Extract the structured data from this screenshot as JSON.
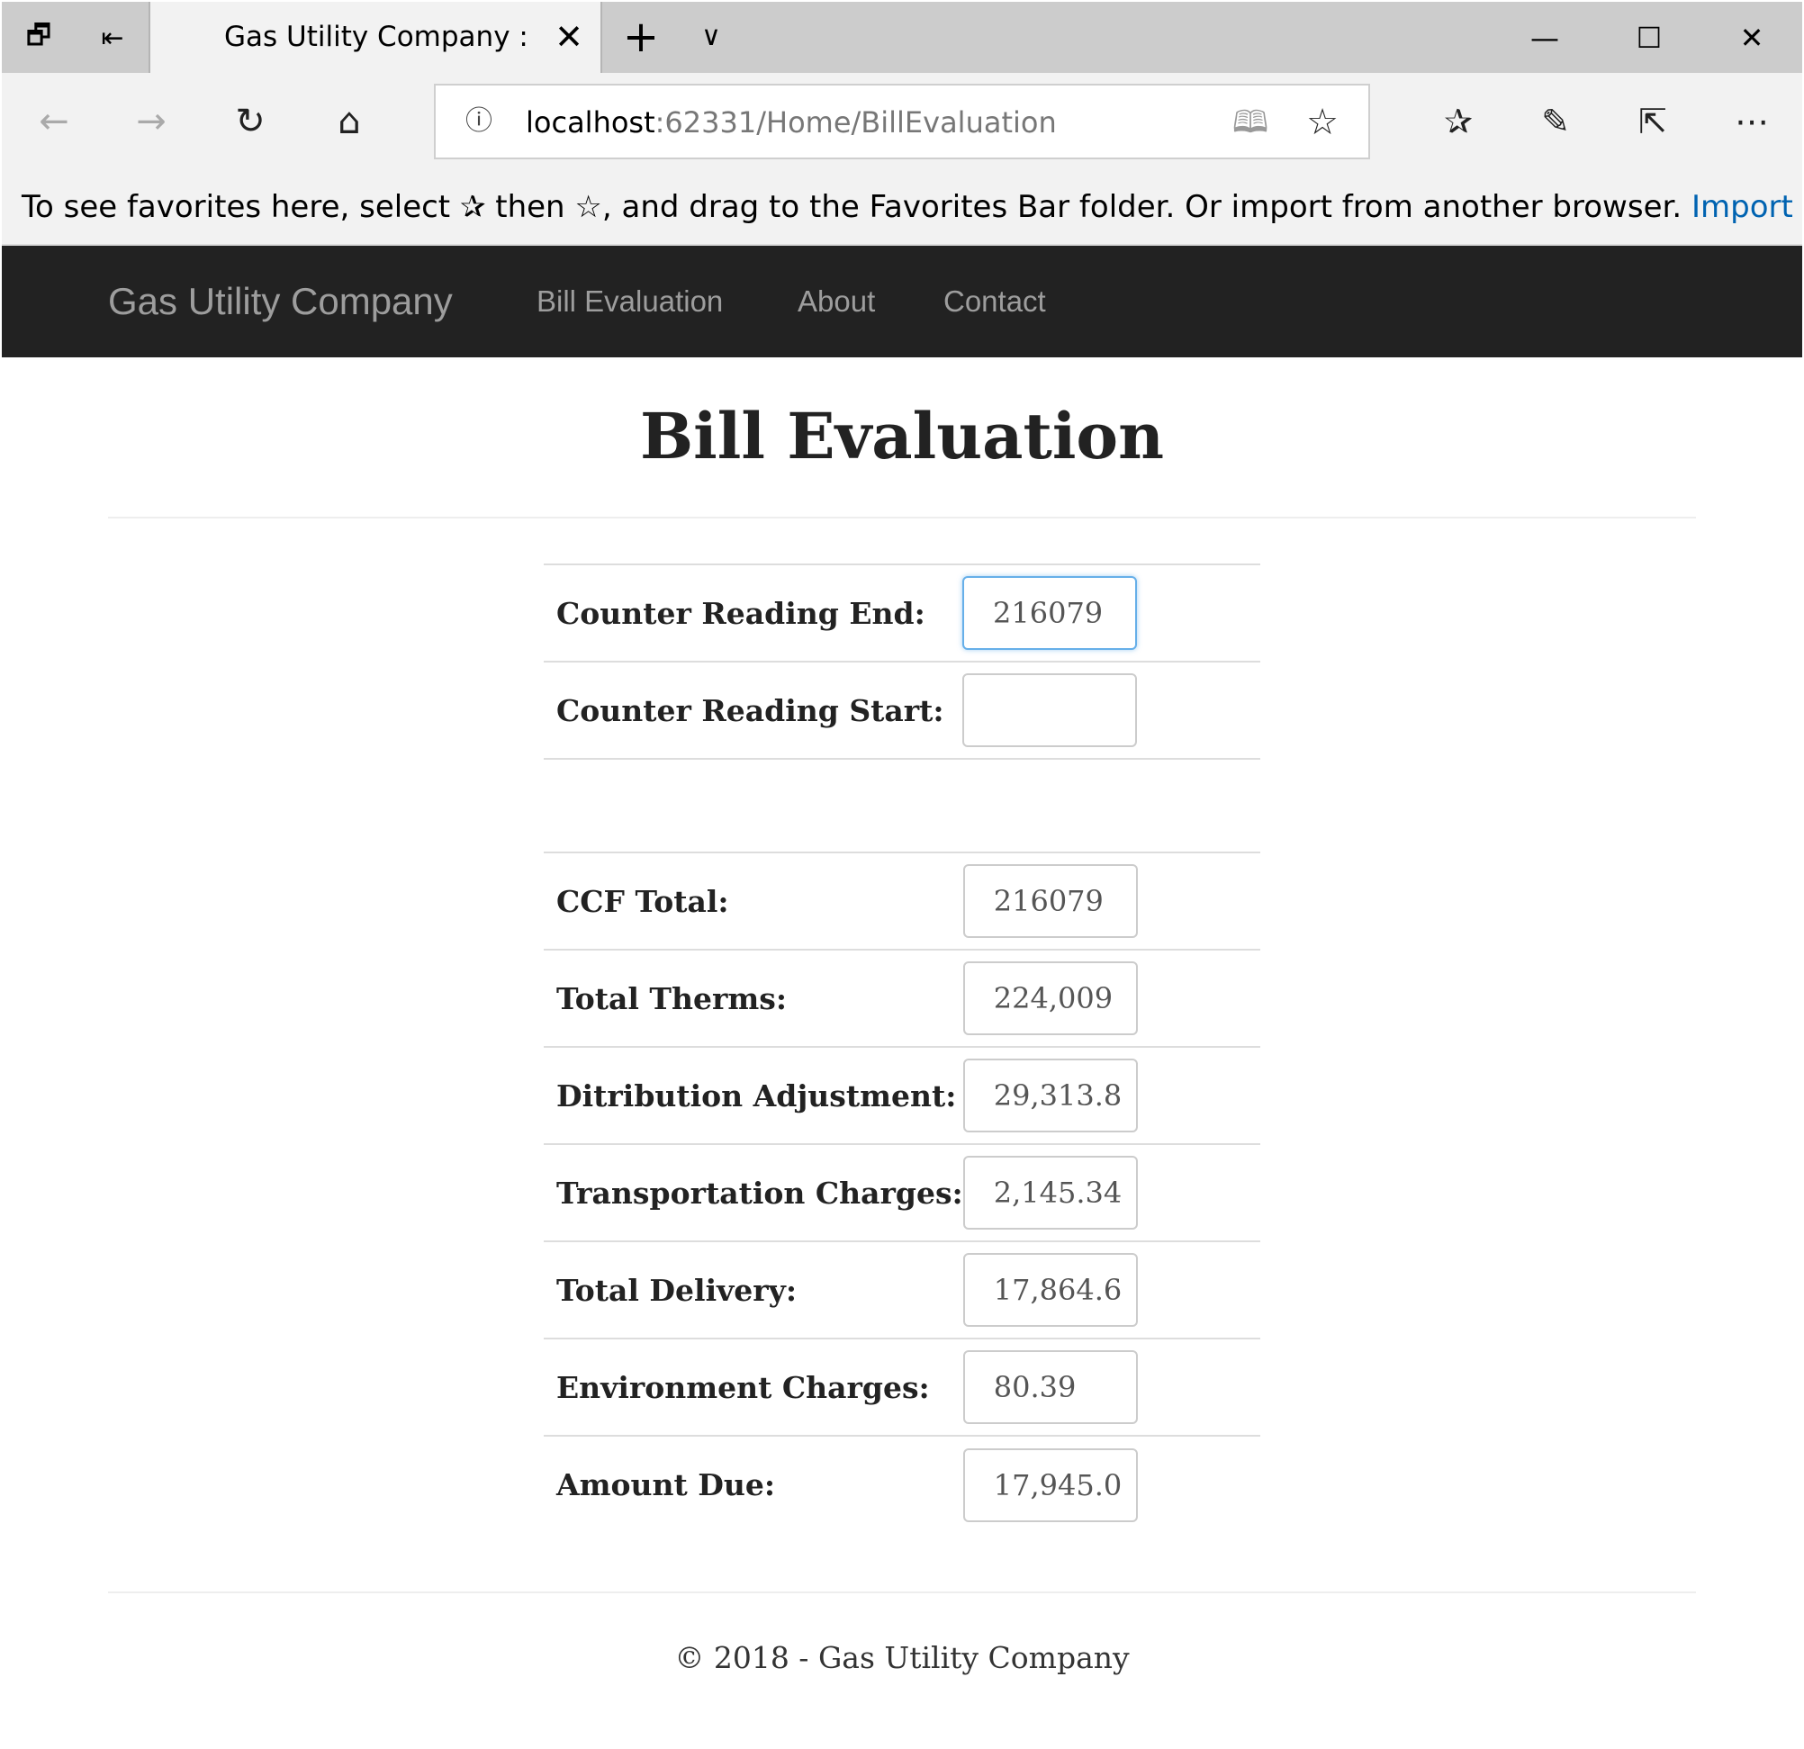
{
  "browser": {
    "tab_title": "Gas Utility Company :: Bill Evaluation",
    "url_host": "localhost",
    "url_rest": ":62331/Home/BillEvaluation",
    "favorites_message": "To see favorites here, select  ✰  then ☆, and drag to the Favorites Bar folder. Or import from another browser.",
    "favorites_import_link": "Import favorites"
  },
  "site": {
    "brand": "Gas Utility Company",
    "nav": [
      "Bill Evaluation",
      "About",
      "Contact"
    ]
  },
  "page": {
    "title": "Bill Evaluation"
  },
  "readings": [
    {
      "label": "Counter Reading End:",
      "value": "216079"
    },
    {
      "label": "Counter Reading Start:",
      "value": ""
    }
  ],
  "results": [
    {
      "label": "CCF Total:",
      "value": "216079"
    },
    {
      "label": "Total Therms:",
      "value": "224,009"
    },
    {
      "label": "Ditribution Adjustment:",
      "value": "29,313.8"
    },
    {
      "label": "Transportation Charges:",
      "value": "2,145.34"
    },
    {
      "label": "Total Delivery:",
      "value": "17,864.6"
    },
    {
      "label": "Environment Charges:",
      "value": "80.39"
    },
    {
      "label": "Amount Due:",
      "value": "17,945.0"
    }
  ],
  "footer": "© 2018 - Gas Utility Company",
  "colors": {
    "navbar_bg": "#222222",
    "nav_text": "#9d9d9d",
    "link_blue": "#0063b1",
    "focus_border": "#66afe9"
  }
}
